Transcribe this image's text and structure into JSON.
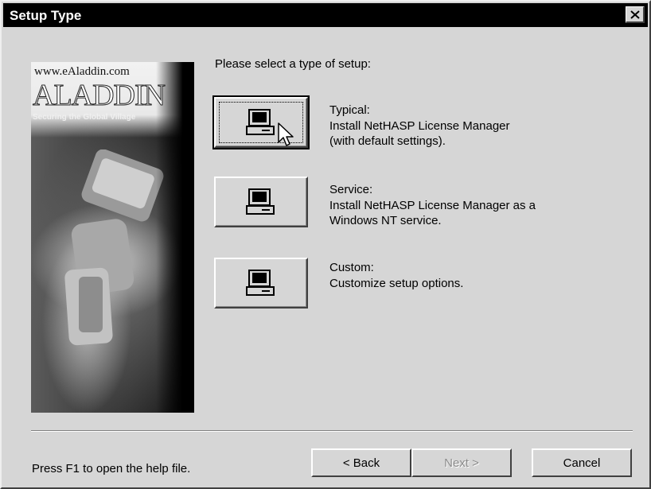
{
  "window": {
    "title": "Setup Type",
    "close_icon": "close-icon"
  },
  "banner": {
    "url": "www.eAladdin.com",
    "logo": "ALADDIN",
    "tagline": "Securing the Global Village"
  },
  "prompt": "Please select a type of setup:",
  "options": [
    {
      "title": "Typical:",
      "description": "Install NetHASP License Manager\n(with default settings).",
      "icon": "computer-icon"
    },
    {
      "title": "Service:",
      "description": "Install NetHASP License Manager as a\nWindows NT service.",
      "icon": "computer-icon"
    },
    {
      "title": "Custom:",
      "description": "Customize setup options.",
      "icon": "computer-icon"
    }
  ],
  "footer": {
    "help_text": "Press F1 to open the help file.",
    "back_label": "< Back",
    "next_label": "Next >",
    "cancel_label": "Cancel"
  },
  "colors": {
    "face": "#d6d6d6",
    "titlebar": "#000000",
    "title_text": "#ffffff"
  }
}
